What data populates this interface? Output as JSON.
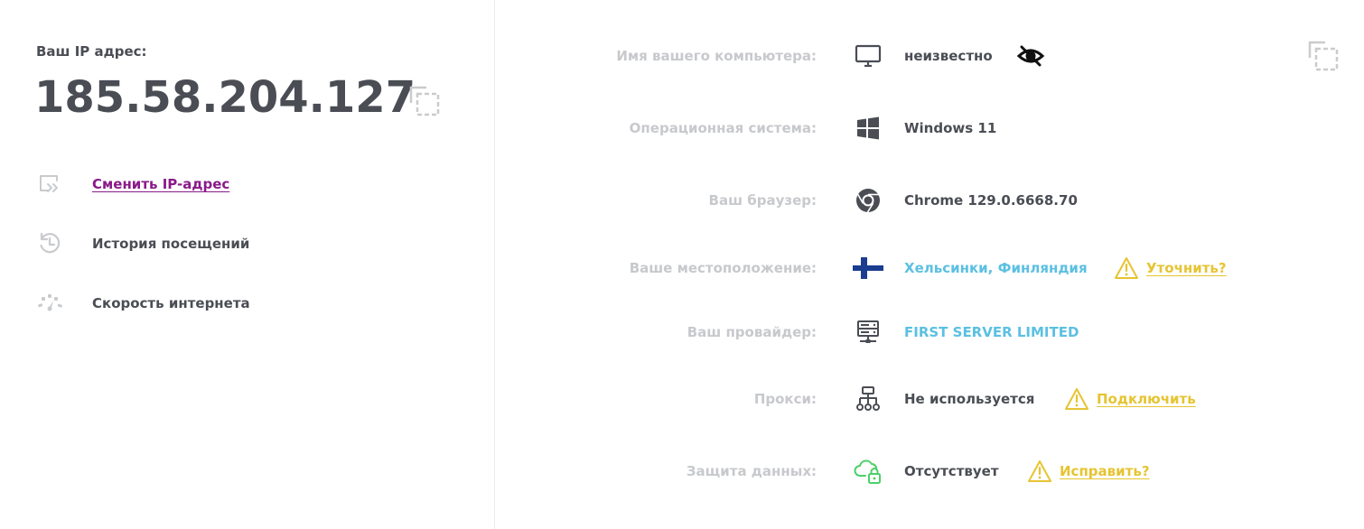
{
  "ip_panel": {
    "label": "Ваш IP адрес:",
    "ip": "185.58.204.127",
    "copy_icon": "copy-icon"
  },
  "menu": [
    {
      "label": "Сменить IP-адрес",
      "icon": "change-ip-icon",
      "link": true
    },
    {
      "label": "История посещений",
      "icon": "history-icon",
      "link": false
    },
    {
      "label": "Скорость интернета",
      "icon": "speedometer-icon",
      "link": false
    }
  ],
  "info": {
    "computer": {
      "label": "Имя вашего компьютера:",
      "value": "неизвестно",
      "icon": "monitor-icon"
    },
    "os": {
      "label": "Операционная система:",
      "value": "Windows 11",
      "icon": "windows-icon"
    },
    "browser": {
      "label": "Ваш браузер:",
      "value": "Chrome 129.0.6668.70",
      "icon": "chrome-icon"
    },
    "location": {
      "label": "Ваше местоположение:",
      "value": "Хельсинки, Финляндия",
      "icon": "finland-flag-icon",
      "warn": "Уточнить?"
    },
    "provider": {
      "label": "Ваш провайдер:",
      "value": "FIRST SERVER LIMITED",
      "icon": "server-icon"
    },
    "proxy": {
      "label": "Прокси:",
      "value": "Не используется",
      "icon": "network-icon",
      "warn": "Подключить"
    },
    "protection": {
      "label": "Защита данных:",
      "value": "Отсутствует",
      "icon": "cloud-lock-icon",
      "warn": "Исправить?"
    }
  },
  "colors": {
    "text": "#4a4d54",
    "label_gray": "#c7c9cc",
    "link_purple": "#8a1a8a",
    "accent_blue": "#5bc0e2",
    "warn_yellow": "#e6c432",
    "lock_green": "#4cd06a",
    "flag_blue": "#1a3d8f"
  }
}
